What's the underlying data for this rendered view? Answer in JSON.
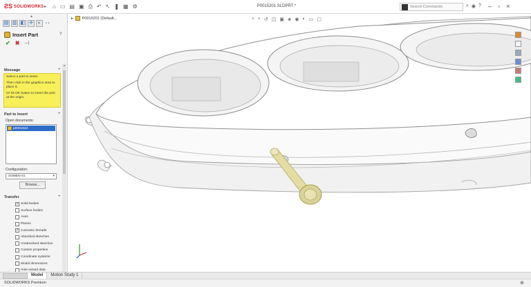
{
  "app": {
    "logo_text": "SOLIDWORKS",
    "document_title": "P0015201.SLDPRT *",
    "search_placeholder": "Search Commands",
    "status_text": "SOLIDWORKS Premium"
  },
  "window_controls": [
    "–",
    "▫",
    "×"
  ],
  "property_manager": {
    "title": "Insert Part",
    "message_header": "Message",
    "messages": [
      "Select a part to insert.",
      "Then click in the graphics area to place it.",
      "Or hit OK button to insert the part at the origin."
    ],
    "part_to_insert_header": "Part to Insert",
    "open_documents_label": "Open documents:",
    "open_documents": [
      "p0001522"
    ],
    "configuration_label": "Configuration:",
    "configuration_value": "SOMEN-01",
    "browse_label": "Browse...",
    "transfer_header": "Transfer",
    "transfer_items": [
      {
        "label": "Solid bodies",
        "checked": true,
        "enabled": true
      },
      {
        "label": "Surface bodies",
        "checked": false,
        "enabled": true
      },
      {
        "label": "Axes",
        "checked": false,
        "enabled": true
      },
      {
        "label": "Planes",
        "checked": false,
        "enabled": true
      },
      {
        "label": "Cosmetic threads",
        "checked": true,
        "enabled": true
      },
      {
        "label": "Absorbed sketches",
        "checked": false,
        "enabled": true
      },
      {
        "label": "Unabsorbed sketches",
        "checked": false,
        "enabled": true
      },
      {
        "label": "Custom properties",
        "checked": false,
        "enabled": true
      },
      {
        "label": "Coordinate systems",
        "checked": false,
        "enabled": true
      },
      {
        "label": "Model dimensions",
        "checked": false,
        "enabled": true
      },
      {
        "label": "Hole wizard data",
        "checked": false,
        "enabled": true
      },
      {
        "label": "Sheet metal information",
        "checked": false,
        "enabled": false
      }
    ]
  },
  "viewport": {
    "tree_flyout_label": "P0015201 (Default..."
  },
  "bottom_tabs": [
    {
      "label": "Model",
      "active": true
    },
    {
      "label": "Motion Study 1",
      "active": false
    }
  ],
  "colors": {
    "accent_red": "#d0202a",
    "message_yellow": "#f8f05a",
    "selection_blue": "#2e6dc7",
    "inserted_part": "#d9d29a"
  },
  "icons": [
    "ok-icon",
    "cancel-icon",
    "pin-icon",
    "help-icon",
    "search-icon",
    "triad-icon"
  ]
}
